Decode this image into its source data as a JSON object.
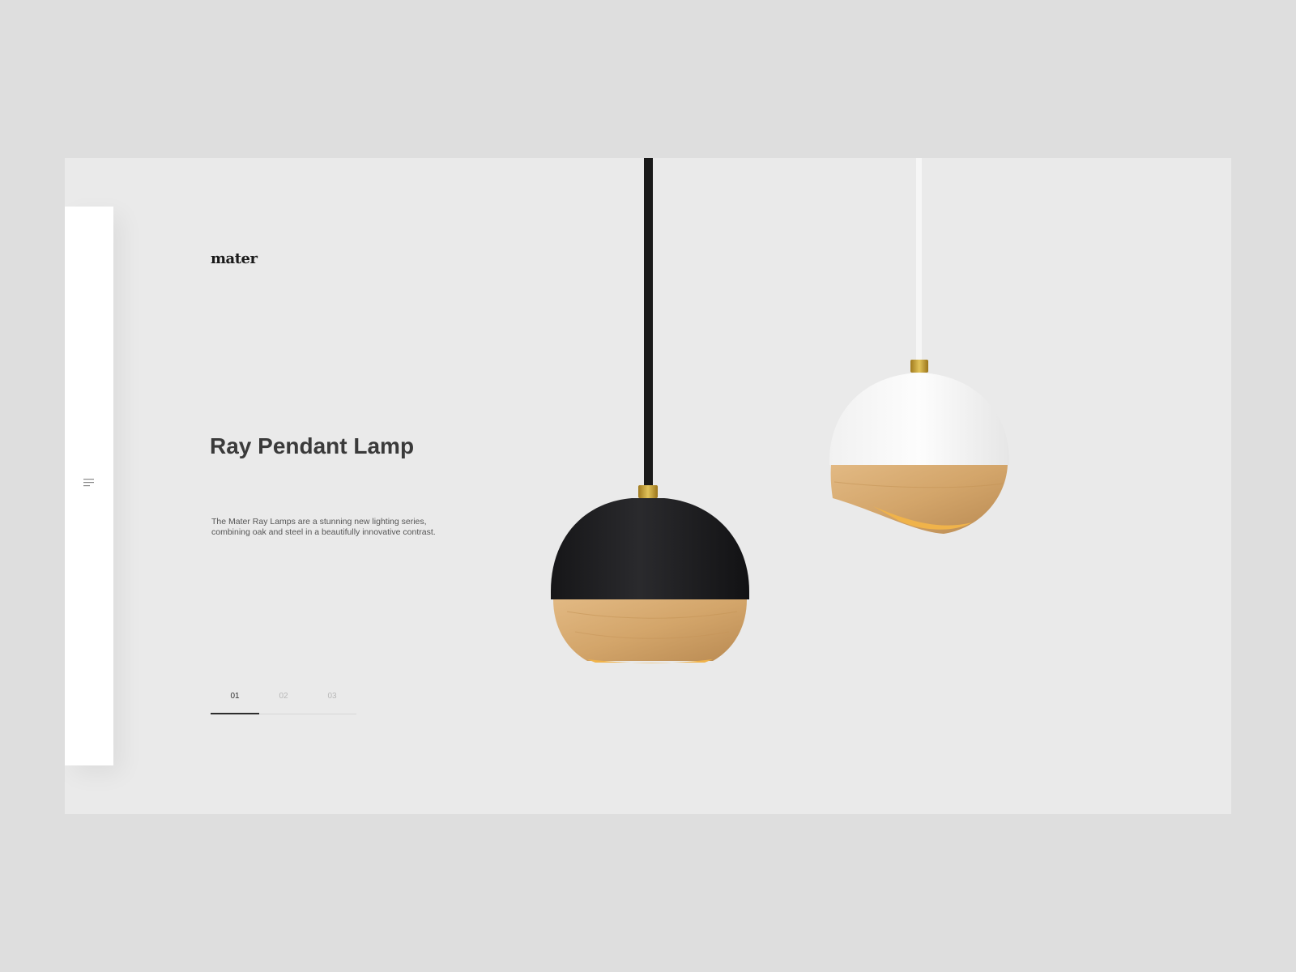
{
  "brand": {
    "logo_text": "mater"
  },
  "sidebar": {
    "menu_icon": "menu-icon"
  },
  "hero": {
    "title": "Ray Pendant Lamp",
    "description": "The Mater Ray Lamps are a stunning new lighting series, combining oak and steel in a beautifully innovative contrast."
  },
  "pager": {
    "tabs": [
      {
        "label": "01",
        "active": true
      },
      {
        "label": "02",
        "active": false
      },
      {
        "label": "03",
        "active": false
      }
    ]
  },
  "products": [
    {
      "name": "black-pendant-lamp",
      "shade_color": "#1f1f21",
      "wood_color": "#d4a66c"
    },
    {
      "name": "white-pendant-lamp",
      "shade_color": "#f6f6f6",
      "wood_color": "#d4a66c"
    }
  ],
  "colors": {
    "page_bg": "#dedede",
    "stage_bg": "#eaeaea",
    "panel_bg": "#ffffff",
    "text_dark": "#3a3a3a",
    "brass": "#c9a23a"
  }
}
